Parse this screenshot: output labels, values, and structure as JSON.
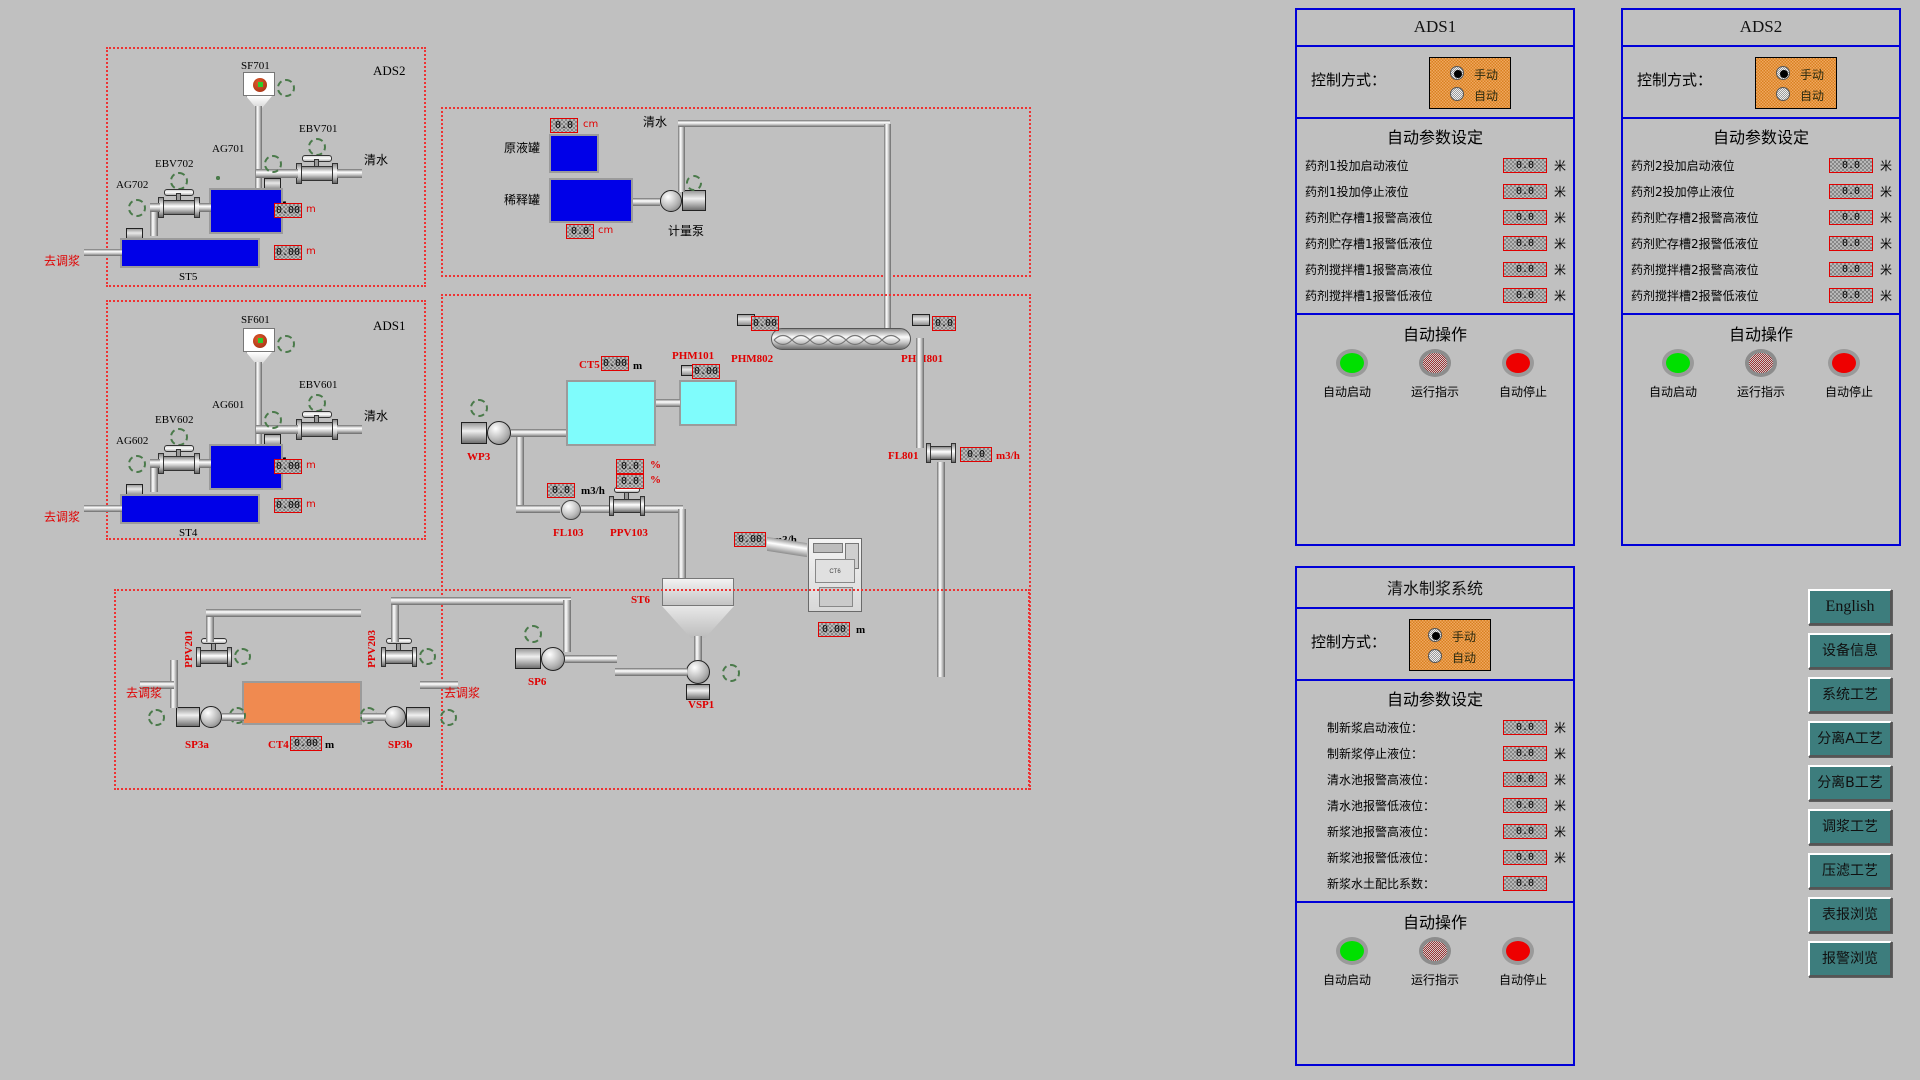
{
  "screen": {
    "bg": "#c0c0c0",
    "accent_blue": "#0000d8",
    "accent_red": "#e33333"
  },
  "diagram": {
    "groups": [
      {
        "id": "ads2",
        "title": "ADS2"
      },
      {
        "id": "ads1",
        "title": "ADS1"
      }
    ],
    "tags_ads2": {
      "feeder": "SF701",
      "valve_right": "EBV701",
      "valve_left": "EBV702",
      "agitator_upper": "AG701",
      "agitator_lower": "AG702",
      "tank": "ST5",
      "clean_water": "清水",
      "to_slurry": "去调浆",
      "level_upper": "0.00",
      "level_lower": "0.00",
      "unit": "m"
    },
    "tags_ads1": {
      "feeder": "SF601",
      "valve_right": "EBV601",
      "valve_left": "EBV602",
      "agitator_upper": "AG601",
      "agitator_lower": "AG602",
      "tank": "ST4",
      "clean_water": "清水",
      "to_slurry": "去调浆",
      "level_upper": "0.00",
      "level_lower": "0.00",
      "unit": "m"
    },
    "top_mid": {
      "stock_tank_label": "原液罐",
      "dilution_tank_label": "稀释罐",
      "clean_water": "清水",
      "stock_level": "0.0",
      "stock_unit": "cm",
      "dilution_level": "0.0",
      "dilution_unit": "cm",
      "metering_pump": "计量泵"
    },
    "center": {
      "ct5_tag": "CT5",
      "ct5_value": "0.00",
      "ct5_unit": "m",
      "phm101_tag": "PHM101",
      "phm101_value": "0.00",
      "phm802_tag": "PHM802",
      "phm802_value": "0.00",
      "phm801_tag": "PHM801",
      "phm801_value": "0.0",
      "wp3_tag": "WP3",
      "fl103_tag": "FL103",
      "fl103_value": "0.0",
      "fl103_unit": "m3/h",
      "ppv103_tag": "PPV103",
      "ppv103_value_top": "0.0",
      "ppv103_unit_top": "%",
      "ppv103_value_bot": "0.0",
      "ppv103_unit_bot": "%",
      "fl801_tag": "FL801",
      "fl801_value": "0.0",
      "fl801_unit": "m3/h",
      "st6_tag": "ST6",
      "vsp1_tag": "VSP1",
      "sp6_tag": "SP6",
      "feed_value": "0.00",
      "feed_unit": "m3/h",
      "silo_value": "0.00",
      "silo_unit": "m"
    },
    "bottom": {
      "sp3a_tag": "SP3a",
      "sp3b_tag": "SP3b",
      "ct4_tag": "CT4",
      "ct4_value": "0.00",
      "ct4_unit": "m",
      "ppv201_tag": "PPV201",
      "ppv203_tag": "PPV203",
      "to_slurry_left": "去调浆",
      "to_slurry_right": "去调浆"
    }
  },
  "panels": {
    "ads1": {
      "title": "ADS1",
      "mode_label": "控制方式：",
      "mode_options": [
        {
          "label": "手动",
          "selected": true
        },
        {
          "label": "自动",
          "selected": false
        }
      ],
      "params_title": "自动参数设定",
      "params": [
        {
          "name": "药剂1投加启动液位",
          "value": "0.0",
          "unit": "米"
        },
        {
          "name": "药剂1投加停止液位",
          "value": "0.0",
          "unit": "米"
        },
        {
          "name": "药剂贮存槽1报警高液位",
          "value": "0.0",
          "unit": "米"
        },
        {
          "name": "药剂贮存槽1报警低液位",
          "value": "0.0",
          "unit": "米"
        },
        {
          "name": "药剂搅拌槽1报警高液位",
          "value": "0.0",
          "unit": "米"
        },
        {
          "name": "药剂搅拌槽1报警低液位",
          "value": "0.0",
          "unit": "米"
        }
      ],
      "ops_title": "自动操作",
      "ops": [
        {
          "label": "自动启动",
          "state": "green"
        },
        {
          "label": "运行指示",
          "state": "dim"
        },
        {
          "label": "自动停止",
          "state": "red"
        }
      ]
    },
    "ads2": {
      "title": "ADS2",
      "mode_label": "控制方式：",
      "mode_options": [
        {
          "label": "手动",
          "selected": true
        },
        {
          "label": "自动",
          "selected": false
        }
      ],
      "params_title": "自动参数设定",
      "params": [
        {
          "name": "药剂2投加启动液位",
          "value": "0.0",
          "unit": "米"
        },
        {
          "name": "药剂2投加停止液位",
          "value": "0.0",
          "unit": "米"
        },
        {
          "name": "药剂贮存槽2报警高液位",
          "value": "0.0",
          "unit": "米"
        },
        {
          "name": "药剂贮存槽2报警低液位",
          "value": "0.0",
          "unit": "米"
        },
        {
          "name": "药剂搅拌槽2报警高液位",
          "value": "0.0",
          "unit": "米"
        },
        {
          "name": "药剂搅拌槽2报警低液位",
          "value": "0.0",
          "unit": "米"
        }
      ],
      "ops_title": "自动操作",
      "ops": [
        {
          "label": "自动启动",
          "state": "green"
        },
        {
          "label": "运行指示",
          "state": "dim"
        },
        {
          "label": "自动停止",
          "state": "red"
        }
      ]
    },
    "clean_water": {
      "title": "清水制浆系统",
      "mode_label": "控制方式：",
      "mode_options": [
        {
          "label": "手动",
          "selected": true
        },
        {
          "label": "自动",
          "selected": false
        }
      ],
      "params_title": "自动参数设定",
      "params": [
        {
          "name": "制新浆启动液位：",
          "value": "0.0",
          "unit": "米"
        },
        {
          "name": "制新浆停止液位：",
          "value": "0.0",
          "unit": "米"
        },
        {
          "name": "清水池报警高液位：",
          "value": "0.0",
          "unit": "米"
        },
        {
          "name": "清水池报警低液位：",
          "value": "0.0",
          "unit": "米"
        },
        {
          "name": "新浆池报警高液位：",
          "value": "0.0",
          "unit": "米"
        },
        {
          "name": "新浆池报警低液位：",
          "value": "0.0",
          "unit": "米"
        },
        {
          "name": "新浆水土配比系数：",
          "value": "0.0",
          "unit": ""
        }
      ],
      "ops_title": "自动操作",
      "ops": [
        {
          "label": "自动启动",
          "state": "green"
        },
        {
          "label": "运行指示",
          "state": "dim"
        },
        {
          "label": "自动停止",
          "state": "red"
        }
      ]
    }
  },
  "nav": {
    "buttons": [
      {
        "label": "English"
      },
      {
        "label": "设备信息"
      },
      {
        "label": "系统工艺"
      },
      {
        "label": "分离A工艺"
      },
      {
        "label": "分离B工艺"
      },
      {
        "label": "调浆工艺"
      },
      {
        "label": "压滤工艺"
      },
      {
        "label": "表报浏览"
      },
      {
        "label": "报警浏览"
      }
    ]
  }
}
